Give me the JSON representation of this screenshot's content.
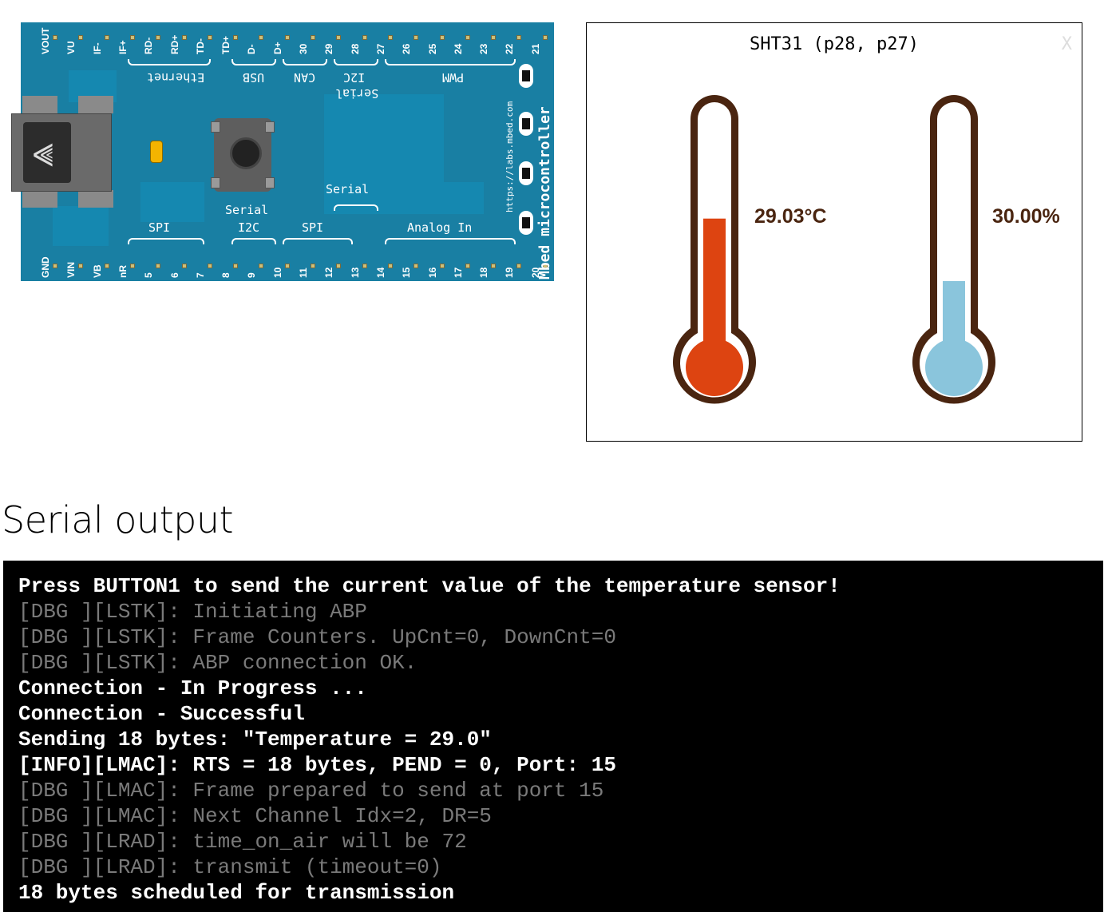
{
  "board": {
    "top_pins": [
      "VOUT",
      "VU",
      "IF-",
      "IF+",
      "RD-",
      "RD+",
      "TD-",
      "TD+",
      "D-",
      "D+",
      "30",
      "29",
      "28",
      "27",
      "26",
      "25",
      "24",
      "23",
      "22",
      "21"
    ],
    "bottom_pins": [
      "GND",
      "VIN",
      "VB",
      "nR",
      "5",
      "6",
      "7",
      "8",
      "9",
      "10",
      "11",
      "12",
      "13",
      "14",
      "15",
      "16",
      "17",
      "18",
      "19",
      "20"
    ],
    "top_groups": [
      "Ethernet",
      "USB",
      "CAN",
      "I2C",
      "Serial",
      "PWM"
    ],
    "bottom_groups": [
      "SPI",
      "Serial",
      "I2C",
      "SPI",
      "Serial",
      "Analog In"
    ],
    "url": "https://labs.mbed.com",
    "brand": "Mbed microcontroller"
  },
  "sensor": {
    "title": "SHT31 (p28, p27)",
    "close_label": "X",
    "temperature": {
      "label": "29.03°C",
      "fill_fraction": 0.57,
      "color": "#dd4411"
    },
    "humidity": {
      "label": "30.00%",
      "fill_fraction": 0.3,
      "color": "#8ac5dc"
    },
    "outline_color": "#4a2510"
  },
  "serial": {
    "heading": "Serial output",
    "lines": [
      {
        "text": "Press BUTTON1 to send the current value of the temperature sensor!",
        "level": "info"
      },
      {
        "text": "[DBG ][LSTK]: Initiating ABP",
        "level": "dbg"
      },
      {
        "text": "[DBG ][LSTK]: Frame Counters. UpCnt=0, DownCnt=0",
        "level": "dbg"
      },
      {
        "text": "[DBG ][LSTK]: ABP connection OK.",
        "level": "dbg"
      },
      {
        "text": "Connection - In Progress ...",
        "level": "info"
      },
      {
        "text": "Connection - Successful",
        "level": "info"
      },
      {
        "text": "Sending 18 bytes: \"Temperature = 29.0\"",
        "level": "info"
      },
      {
        "text": "[INFO][LMAC]: RTS = 18 bytes, PEND = 0, Port: 15",
        "level": "info"
      },
      {
        "text": "[DBG ][LMAC]: Frame prepared to send at port 15",
        "level": "dbg"
      },
      {
        "text": "[DBG ][LMAC]: Next Channel Idx=2, DR=5",
        "level": "dbg"
      },
      {
        "text": "[DBG ][LRAD]: time_on_air will be 72",
        "level": "dbg"
      },
      {
        "text": "[DBG ][LRAD]: transmit (timeout=0)",
        "level": "dbg"
      },
      {
        "text": "18 bytes scheduled for transmission",
        "level": "info"
      }
    ]
  }
}
